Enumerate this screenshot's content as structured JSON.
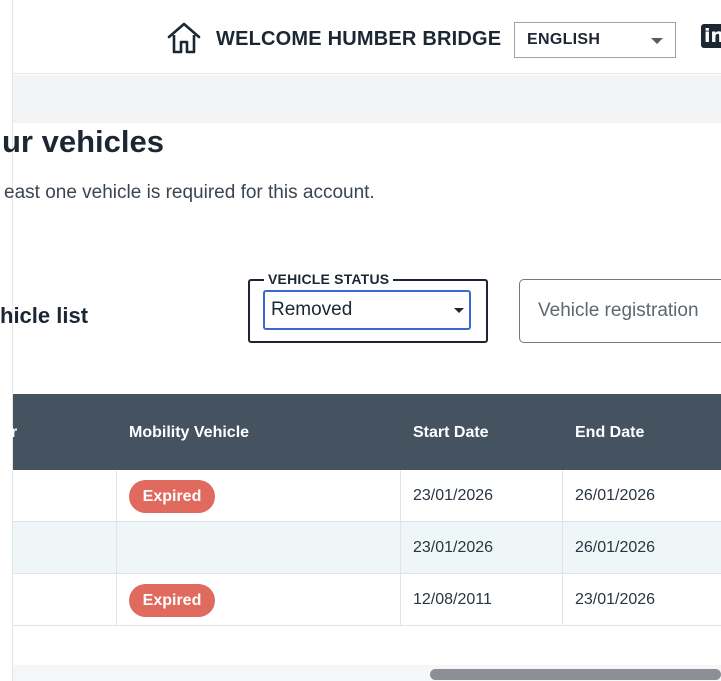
{
  "header": {
    "welcome": "WELCOME HUMBER BRIDGE",
    "language": "ENGLISH",
    "home_icon": "home-icon",
    "social_icon": "linkedin-icon",
    "social_glyph": "in"
  },
  "page": {
    "title": "ur vehicles",
    "subtitle": "east one vehicle is required for this account."
  },
  "vehicle_list": {
    "title": "hicle list",
    "status_label": "VEHICLE STATUS",
    "status_value": "Removed",
    "registration_placeholder": "Vehicle registration"
  },
  "table": {
    "headers": [
      "r",
      "Mobility Vehicle",
      "Start Date",
      "End Date"
    ],
    "rows": [
      {
        "mobility": "Expired",
        "start": "23/01/2026",
        "end": "26/01/2026"
      },
      {
        "mobility": "",
        "start": "23/01/2026",
        "end": "26/01/2026"
      },
      {
        "mobility": "Expired",
        "start": "12/08/2011",
        "end": "23/01/2026"
      }
    ]
  },
  "colors": {
    "table_header": "#44535f",
    "badge_expired": "#e06a5e",
    "focus_border": "#3b67d6",
    "alt_row": "#eef6f8"
  }
}
